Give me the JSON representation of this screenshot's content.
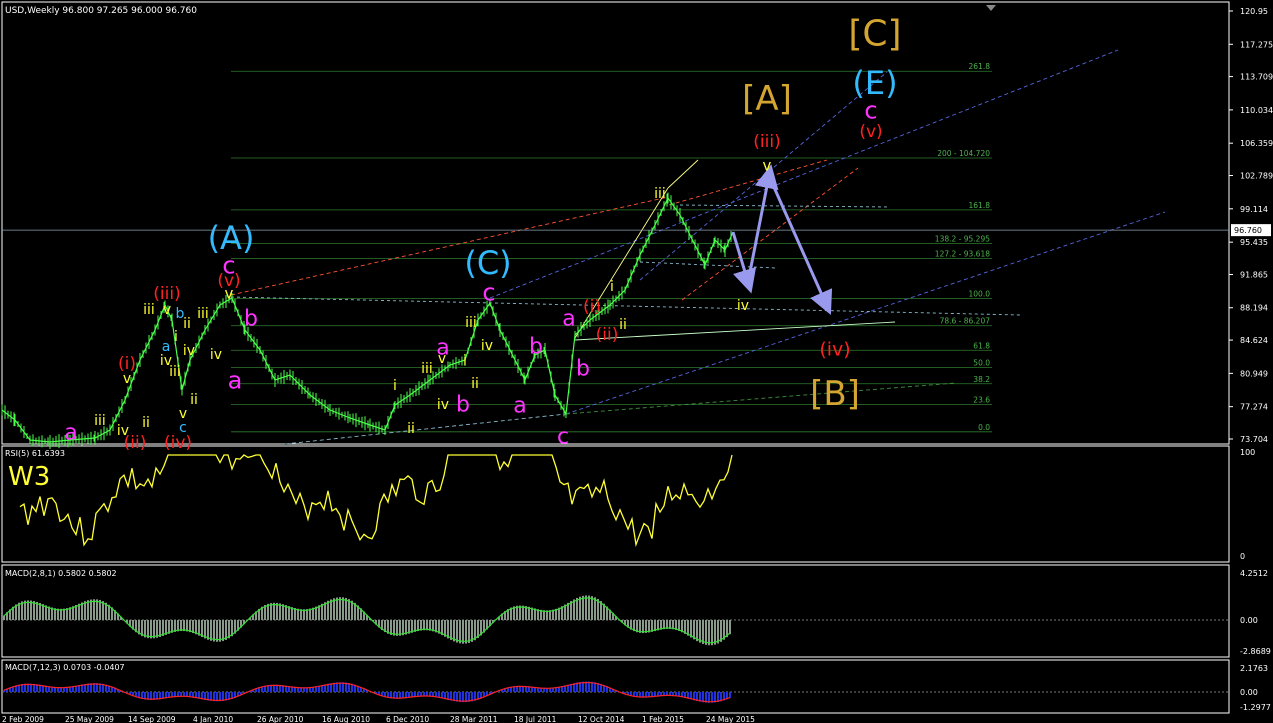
{
  "window": {
    "title_line": "USD,Weekly  96.800 97.265 96.000 96.760",
    "current_price_tag": "96.760"
  },
  "colors": {
    "background": "#000000",
    "panel_border": "#ffffff",
    "fib_line": "#2f7a2f",
    "bars": "#4cff4c",
    "rsi_line": "#ffff33",
    "macd_hist": "#8a9a8a",
    "macd_signal": "#33dd33",
    "macd2_hist": "#2233dd",
    "macd2_signal": "#ff2222",
    "label_yellow": "#ffff33",
    "label_magenta": "#ff33ff",
    "label_red": "#ff2222",
    "label_cyan": "#33bbff",
    "label_orange": "#d4a531",
    "projection_arrow": "#9999ee"
  },
  "chart_data": [
    {
      "type": "line",
      "name": "main",
      "ylim": [
        73.704,
        120.95
      ],
      "price_ticks": [
        "120.95",
        "117.275",
        "113.709",
        "110.034",
        "106.359",
        "102.789",
        "99.114",
        "95.435",
        "91.865",
        "88.194",
        "84.624",
        "80.949",
        "77.274",
        "73.704"
      ],
      "x_ticks": [
        "2 Feb 2009",
        "25 May 2009",
        "14 Sep 2009",
        "4 Jan 2010",
        "26 Apr 2010",
        "16 Aug 2010",
        "6 Dec 2010",
        "28 Mar 2011",
        "18 Jul 2011",
        "12 Oct 2014",
        "1 Feb 2015",
        "24 May 2015"
      ],
      "fib_levels": [
        {
          "label": "261.8",
          "value": 114.3
        },
        {
          "label": "200 - 104.720",
          "value": 104.72
        },
        {
          "label": "161.8",
          "value": 99.0
        },
        {
          "label": "138.2 - 95.295",
          "value": 95.295
        },
        {
          "label": "127.2 - 93.618",
          "value": 93.618
        },
        {
          "label": "100.0",
          "value": 89.2
        },
        {
          "label": "78.6 - 86.207",
          "value": 86.207
        },
        {
          "label": "61.8",
          "value": 83.5
        },
        {
          "label": "50.0",
          "value": 81.6
        },
        {
          "label": "38.2",
          "value": 79.8
        },
        {
          "label": "23.6",
          "value": 77.5
        },
        {
          "label": "0.0",
          "value": 74.5
        }
      ],
      "wave_labels": [
        {
          "text": "[C]",
          "color": "orange",
          "x": 875,
          "y": 33,
          "size": 36
        },
        {
          "text": "(E)",
          "color": "cyan",
          "x": 875,
          "y": 83,
          "size": 32
        },
        {
          "text": "c",
          "color": "magenta",
          "x": 871,
          "y": 110,
          "size": 24
        },
        {
          "text": "(v)",
          "color": "red",
          "x": 871,
          "y": 131,
          "size": 17
        },
        {
          "text": "[A]",
          "color": "orange",
          "x": 767,
          "y": 98,
          "size": 34
        },
        {
          "text": "(iii)",
          "color": "red",
          "x": 767,
          "y": 141,
          "size": 17
        },
        {
          "text": "v",
          "color": "yellow",
          "x": 767,
          "y": 165,
          "size": 15
        },
        {
          "text": "iii",
          "color": "yellow",
          "x": 660,
          "y": 193,
          "size": 14
        },
        {
          "text": "(A)",
          "color": "cyan",
          "x": 231,
          "y": 238,
          "size": 32
        },
        {
          "text": "c",
          "color": "magenta",
          "x": 229,
          "y": 265,
          "size": 24
        },
        {
          "text": "(v)",
          "color": "red",
          "x": 229,
          "y": 280,
          "size": 17
        },
        {
          "text": "v",
          "color": "yellow",
          "x": 229,
          "y": 293,
          "size": 15
        },
        {
          "text": "b",
          "color": "magenta",
          "x": 251,
          "y": 318,
          "size": 22
        },
        {
          "text": "a",
          "color": "magenta",
          "x": 235,
          "y": 380,
          "size": 24
        },
        {
          "text": "(iii)",
          "color": "red",
          "x": 167,
          "y": 293,
          "size": 17
        },
        {
          "text": "iii",
          "color": "yellow",
          "x": 149,
          "y": 309,
          "size": 14
        },
        {
          "text": "v",
          "color": "yellow",
          "x": 167,
          "y": 309,
          "size": 14
        },
        {
          "text": "b",
          "color": "cyan",
          "x": 180,
          "y": 313,
          "size": 14
        },
        {
          "text": "iii",
          "color": "yellow",
          "x": 203,
          "y": 313,
          "size": 14
        },
        {
          "text": "ii",
          "color": "yellow",
          "x": 187,
          "y": 323,
          "size": 14
        },
        {
          "text": "i",
          "color": "yellow",
          "x": 176,
          "y": 336,
          "size": 14
        },
        {
          "text": "a",
          "color": "cyan",
          "x": 166,
          "y": 346,
          "size": 14
        },
        {
          "text": "iv",
          "color": "yellow",
          "x": 189,
          "y": 350,
          "size": 14
        },
        {
          "text": "iv",
          "color": "yellow",
          "x": 216,
          "y": 354,
          "size": 14
        },
        {
          "text": "iv",
          "color": "yellow",
          "x": 166,
          "y": 360,
          "size": 14
        },
        {
          "text": "iii",
          "color": "yellow",
          "x": 175,
          "y": 371,
          "size": 14
        },
        {
          "text": "(i)",
          "color": "red",
          "x": 127,
          "y": 363,
          "size": 17
        },
        {
          "text": "v",
          "color": "yellow",
          "x": 127,
          "y": 378,
          "size": 14
        },
        {
          "text": "ii",
          "color": "yellow",
          "x": 194,
          "y": 399,
          "size": 14
        },
        {
          "text": "iii",
          "color": "yellow",
          "x": 100,
          "y": 420,
          "size": 14
        },
        {
          "text": "ii",
          "color": "yellow",
          "x": 146,
          "y": 422,
          "size": 14
        },
        {
          "text": "v",
          "color": "yellow",
          "x": 183,
          "y": 413,
          "size": 14
        },
        {
          "text": "c",
          "color": "cyan",
          "x": 183,
          "y": 427,
          "size": 14
        },
        {
          "text": "iv",
          "color": "yellow",
          "x": 123,
          "y": 430,
          "size": 14
        },
        {
          "text": "a",
          "color": "magenta",
          "x": 71,
          "y": 432,
          "size": 22
        },
        {
          "text": "(ii)",
          "color": "red",
          "x": 135,
          "y": 442,
          "size": 17
        },
        {
          "text": "(iv)",
          "color": "red",
          "x": 178,
          "y": 442,
          "size": 17
        },
        {
          "text": "(C)",
          "color": "cyan",
          "x": 488,
          "y": 263,
          "size": 32
        },
        {
          "text": "c",
          "color": "magenta",
          "x": 489,
          "y": 292,
          "size": 24
        },
        {
          "text": "iii",
          "color": "yellow",
          "x": 471,
          "y": 322,
          "size": 14
        },
        {
          "text": "iv",
          "color": "yellow",
          "x": 487,
          "y": 345,
          "size": 14
        },
        {
          "text": "b",
          "color": "magenta",
          "x": 536,
          "y": 346,
          "size": 22
        },
        {
          "text": "a",
          "color": "magenta",
          "x": 443,
          "y": 347,
          "size": 22
        },
        {
          "text": "v",
          "color": "yellow",
          "x": 442,
          "y": 358,
          "size": 14
        },
        {
          "text": "iii",
          "color": "yellow",
          "x": 427,
          "y": 368,
          "size": 14
        },
        {
          "text": "i",
          "color": "yellow",
          "x": 465,
          "y": 360,
          "size": 14
        },
        {
          "text": "ii",
          "color": "yellow",
          "x": 475,
          "y": 383,
          "size": 14
        },
        {
          "text": "i",
          "color": "yellow",
          "x": 395,
          "y": 385,
          "size": 14
        },
        {
          "text": "iv",
          "color": "yellow",
          "x": 443,
          "y": 404,
          "size": 14
        },
        {
          "text": "b",
          "color": "magenta",
          "x": 463,
          "y": 404,
          "size": 22
        },
        {
          "text": "a",
          "color": "magenta",
          "x": 520,
          "y": 405,
          "size": 22
        },
        {
          "text": "ii",
          "color": "yellow",
          "x": 411,
          "y": 428,
          "size": 14
        },
        {
          "text": "c",
          "color": "magenta",
          "x": 563,
          "y": 436,
          "size": 22
        },
        {
          "text": "a",
          "color": "magenta",
          "x": 569,
          "y": 318,
          "size": 22
        },
        {
          "text": "(i)",
          "color": "red",
          "x": 592,
          "y": 306,
          "size": 17
        },
        {
          "text": "i",
          "color": "yellow",
          "x": 612,
          "y": 286,
          "size": 14
        },
        {
          "text": "(ii)",
          "color": "red",
          "x": 607,
          "y": 334,
          "size": 17
        },
        {
          "text": "ii",
          "color": "yellow",
          "x": 623,
          "y": 324,
          "size": 14
        },
        {
          "text": "b",
          "color": "magenta",
          "x": 583,
          "y": 368,
          "size": 22
        },
        {
          "text": "iv",
          "color": "yellow",
          "x": 743,
          "y": 305,
          "size": 14
        },
        {
          "text": "(iv)",
          "color": "red",
          "x": 835,
          "y": 349,
          "size": 19
        },
        {
          "text": "[B]",
          "color": "orange",
          "x": 835,
          "y": 393,
          "size": 34
        }
      ]
    },
    {
      "type": "line",
      "name": "RSI(5)",
      "header": "RSI(5) 61.6393",
      "ylim": [
        0,
        100
      ],
      "ticks": [
        "100",
        "0"
      ],
      "overlay_label": "W3"
    },
    {
      "type": "bar",
      "name": "MACD(2,8,1)",
      "header": "MACD(2,8,1) 0.5802 0.5802",
      "ticks": [
        "4.2512",
        "0.00",
        "-2.8689"
      ]
    },
    {
      "type": "bar",
      "name": "MACD(7,12,3)",
      "header": "MACD(7,12,3) 0.0703 -0.0407",
      "ticks": [
        "2.1763",
        "0.00",
        "-1.2977"
      ]
    }
  ]
}
